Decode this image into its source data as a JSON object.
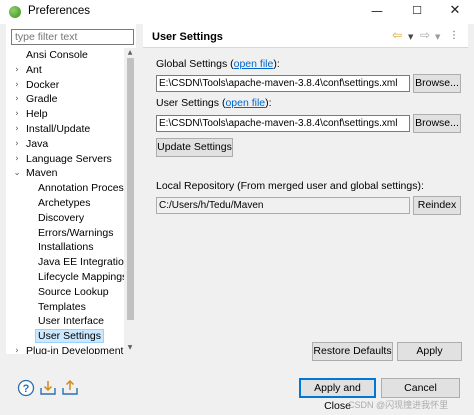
{
  "window": {
    "title": "Preferences"
  },
  "filter": {
    "placeholder": "type filter text"
  },
  "tree": [
    {
      "label": "Ansi Console",
      "arrow": ""
    },
    {
      "label": "Ant",
      "arrow": "›"
    },
    {
      "label": "Docker",
      "arrow": "›"
    },
    {
      "label": "Gradle",
      "arrow": "›"
    },
    {
      "label": "Help",
      "arrow": "›"
    },
    {
      "label": "Install/Update",
      "arrow": "›"
    },
    {
      "label": "Java",
      "arrow": "›"
    },
    {
      "label": "Language Servers",
      "arrow": "›"
    },
    {
      "label": "Maven",
      "arrow": "⌄"
    },
    {
      "label": "Annotation Process",
      "arrow": "",
      "child": true
    },
    {
      "label": "Archetypes",
      "arrow": "",
      "child": true
    },
    {
      "label": "Discovery",
      "arrow": "",
      "child": true
    },
    {
      "label": "Errors/Warnings",
      "arrow": "",
      "child": true
    },
    {
      "label": "Installations",
      "arrow": "",
      "child": true
    },
    {
      "label": "Java EE Integration",
      "arrow": "",
      "child": true
    },
    {
      "label": "Lifecycle Mappings",
      "arrow": "",
      "child": true
    },
    {
      "label": "Source Lookup",
      "arrow": "",
      "child": true
    },
    {
      "label": "Templates",
      "arrow": "",
      "child": true
    },
    {
      "label": "User Interface",
      "arrow": "",
      "child": true
    },
    {
      "label": "User Settings",
      "arrow": "",
      "child": true,
      "selected": true
    },
    {
      "label": "Plug-in Development",
      "arrow": "›"
    }
  ],
  "panel": {
    "title": "User Settings",
    "global_label_prefix": "Global Settings (",
    "global_link": "open file",
    "global_label_suffix": "):",
    "global_path": "E:\\CSDN\\Tools\\apache-maven-3.8.4\\conf\\settings.xml",
    "browse_label": "Browse...",
    "user_label_prefix": "User Settings (",
    "user_link": "open file",
    "user_label_suffix": "):",
    "user_path": "E:\\CSDN\\Tools\\apache-maven-3.8.4\\conf\\settings.xml",
    "update_label": "Update Settings",
    "local_repo_label": "Local Repository (From merged user and global settings):",
    "local_repo_path": "C:/Users/h/Tedu/Maven",
    "reindex_label": "Reindex",
    "restore_label": "Restore Defaults",
    "apply_label": "Apply"
  },
  "footer": {
    "apply_close_label": "Apply and Close",
    "cancel_label": "Cancel",
    "watermark": "CSDN @闪现撞进我怀里"
  },
  "icons": {
    "help": "help-icon",
    "import": "import-icon",
    "export": "export-icon",
    "back": "back-arrow-icon",
    "forward": "forward-arrow-icon",
    "menu": "view-menu-icon"
  }
}
